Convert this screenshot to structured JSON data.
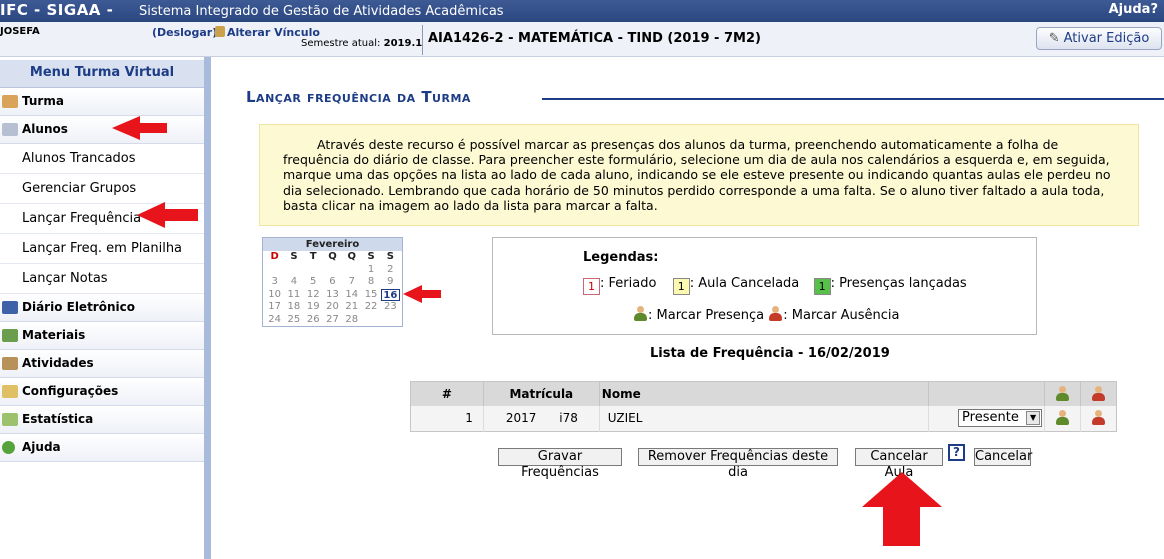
{
  "header": {
    "brand": "IFC - SIGAA -",
    "system_title": "Sistema Integrado de Gestão de Atividades Acadêmicas",
    "help": "Ajuda?"
  },
  "infobar": {
    "user": "JOSEFA",
    "logout": "(Deslogar)",
    "change_link": "Alterar Vínculo",
    "semester_label": "Semestre atual:",
    "semester_value": "2019.1",
    "course": "AIA1426-2 - MATEMÁTICA - TIND (2019 - 7M2)",
    "edit_button": "Ativar Edição"
  },
  "sidebar": {
    "title": "Menu Turma Virtual",
    "sections": [
      {
        "label": "Turma",
        "icon": "class-icon"
      },
      {
        "label": "Alunos",
        "icon": "students-icon"
      },
      {
        "label": "Diário Eletrônico",
        "icon": "diary-icon"
      },
      {
        "label": "Materiais",
        "icon": "materials-icon"
      },
      {
        "label": "Atividades",
        "icon": "activities-icon"
      },
      {
        "label": "Configurações",
        "icon": "settings-folder-icon"
      },
      {
        "label": "Estatística",
        "icon": "statistics-icon"
      },
      {
        "label": "Ajuda",
        "icon": "help-icon"
      }
    ],
    "alunos_items": [
      "Alunos Trancados",
      "Gerenciar Grupos",
      "Lançar Frequência",
      "Lançar Freq. em Planilha",
      "Lançar Notas"
    ]
  },
  "main": {
    "page_title": "Lançar frequência da Turma",
    "notice": "Através deste recurso é possível marcar as presenças dos alunos da turma, preenchendo automaticamente a folha de frequência do diário de classe. Para preencher este formulário, selecione um dia de aula nos calendários a esquerda e, em seguida, marque uma das opções na lista ao lado de cada aluno, indicando se ele esteve presente ou indicando quantas aulas ele perdeu no dia selecionado. Lembrando que cada horário de 50 minutos perdido corresponde a uma falta. Se o aluno tiver faltado a aula toda, basta clicar na imagem ao lado da lista para marcar a falta."
  },
  "calendar": {
    "month": "Fevereiro",
    "weekdays": [
      "D",
      "S",
      "T",
      "Q",
      "Q",
      "S",
      "S"
    ],
    "weeks": [
      [
        "",
        "",
        "",
        "",
        "",
        "1",
        "2"
      ],
      [
        "3",
        "4",
        "5",
        "6",
        "7",
        "8",
        "9"
      ],
      [
        "10",
        "11",
        "12",
        "13",
        "14",
        "15",
        "16"
      ],
      [
        "17",
        "18",
        "19",
        "20",
        "21",
        "22",
        "23"
      ],
      [
        "24",
        "25",
        "26",
        "27",
        "28",
        "",
        ""
      ]
    ],
    "selected_day": "16"
  },
  "legend": {
    "title": "Legendas:",
    "feriado_box": "1",
    "feriado": ": Feriado",
    "cancel_box": "1",
    "cancel": ": Aula Cancelada",
    "pres_box": "1",
    "pres": ": Presenças lançadas",
    "mark_present": ": Marcar Presença",
    "mark_absent": ": Marcar Ausência"
  },
  "attendance": {
    "title": "Lista de Frequência - 16/02/2019",
    "columns": [
      "#",
      "Matrícula",
      "Nome"
    ],
    "rows": [
      {
        "num": "1",
        "matricula": "2017      i78",
        "nome": "UZIEL",
        "status": "Presente"
      }
    ]
  },
  "actions": {
    "save": "Gravar Frequências",
    "remove": "Remover Frequências deste dia",
    "cancel_class": "Cancelar Aula",
    "help": "?",
    "cancel": "Cancelar"
  },
  "colors": {
    "accent": "#1d3c86",
    "header_bg": "#2b4780",
    "notice_bg": "#fdf9d2",
    "arrow": "#e8141b"
  }
}
